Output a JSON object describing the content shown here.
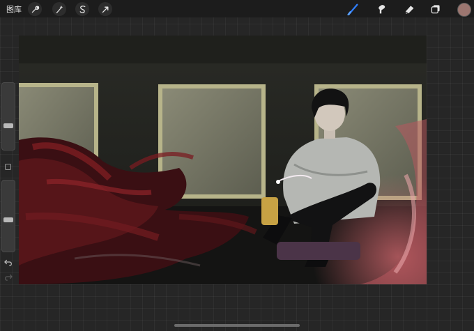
{
  "toolbar": {
    "gallery_label": "图库",
    "left_tools": [
      {
        "icon": "wrench-icon"
      },
      {
        "icon": "magic-wand-icon"
      },
      {
        "icon": "selection-s-icon"
      },
      {
        "icon": "transform-arrow-icon"
      }
    ],
    "right_tools": [
      {
        "icon": "brush-icon",
        "active": true,
        "color": "#2f7cf6"
      },
      {
        "icon": "smudge-icon"
      },
      {
        "icon": "eraser-icon"
      },
      {
        "icon": "layers-icon"
      }
    ],
    "current_color": "#9c7670"
  },
  "sidebar": {
    "brush_size_level": 0.35,
    "opacity_level": 0.45,
    "undo_icon": "undo-icon",
    "redo_icon": "redo-icon"
  },
  "canvas": {
    "artwork": "illustration-seated-figure-red-smoke"
  }
}
